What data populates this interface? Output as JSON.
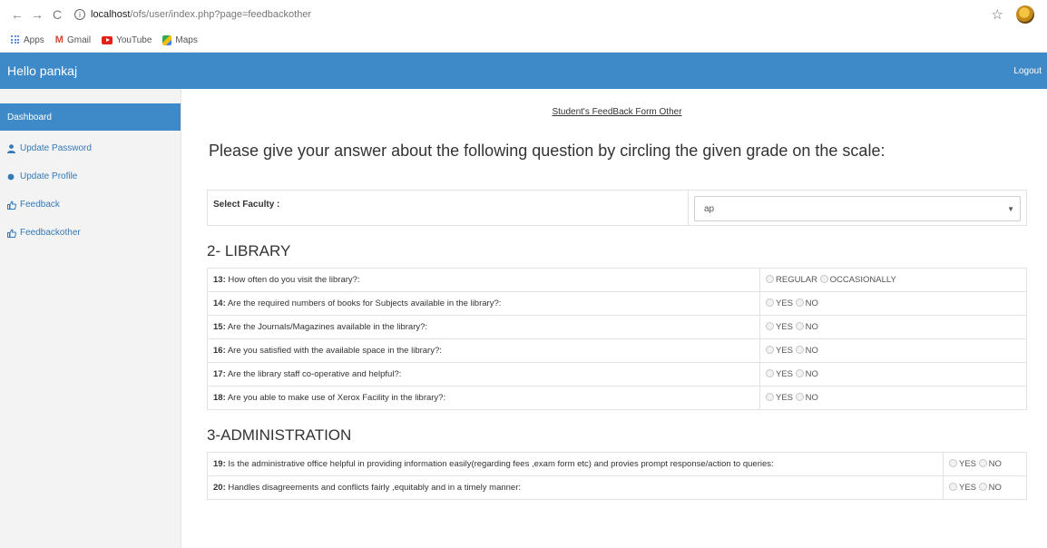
{
  "browser": {
    "url_host": "localhost",
    "url_path": "/ofs/user/index.php?page=feedbackother",
    "bookmarks": [
      "Apps",
      "Gmail",
      "YouTube",
      "Maps"
    ]
  },
  "header": {
    "brand": "Hello pankaj",
    "logout": "Logout"
  },
  "sidebar": {
    "items": [
      {
        "label": "Dashboard",
        "icon": "none"
      },
      {
        "label": "Update Password",
        "icon": "user-icon"
      },
      {
        "label": "Update Profile",
        "icon": "circle-icon"
      },
      {
        "label": "Feedback",
        "icon": "thumbs-up-icon"
      },
      {
        "label": "Feedbackother",
        "icon": "thumbs-up-icon"
      }
    ]
  },
  "main": {
    "form_title": "Student's FeedBack Form Other",
    "lead": "Please give your answer about the following question by circling the given grade on the scale:",
    "faculty": {
      "label": "Select Faculty :",
      "value": "ap"
    },
    "sections": [
      {
        "title": "2- LIBRARY",
        "questions": [
          {
            "num": "13:",
            "text": " How often do you visit the library?:",
            "options": [
              "REGULAR",
              "OCCASIONALLY"
            ]
          },
          {
            "num": "14:",
            "text": " Are the required numbers of books for Subjects available in the library?:",
            "options": [
              "YES",
              "NO"
            ]
          },
          {
            "num": "15:",
            "text": " Are the Journals/Magazines available in the library?:",
            "options": [
              "YES",
              "NO"
            ]
          },
          {
            "num": "16:",
            "text": " Are you satisfied with the available space in the library?:",
            "options": [
              "YES",
              "NO"
            ]
          },
          {
            "num": "17:",
            "text": " Are the library staff co-operative and helpful?:",
            "options": [
              "YES",
              "NO"
            ]
          },
          {
            "num": "18:",
            "text": " Are you able to make use of Xerox Facility in the library?:",
            "options": [
              "YES",
              "NO"
            ]
          }
        ]
      },
      {
        "title": "3-ADMINISTRATION",
        "questions": [
          {
            "num": "19:",
            "text": " Is the administrative office helpful in providing information easily(regarding fees ,exam form etc) and provies prompt response/action to queries:",
            "options": [
              "YES",
              "NO"
            ]
          },
          {
            "num": "20:",
            "text": " Handles disagreements and conflicts fairly ,equitably and in a timely manner:",
            "options": [
              "YES",
              "NO"
            ]
          }
        ]
      }
    ]
  }
}
